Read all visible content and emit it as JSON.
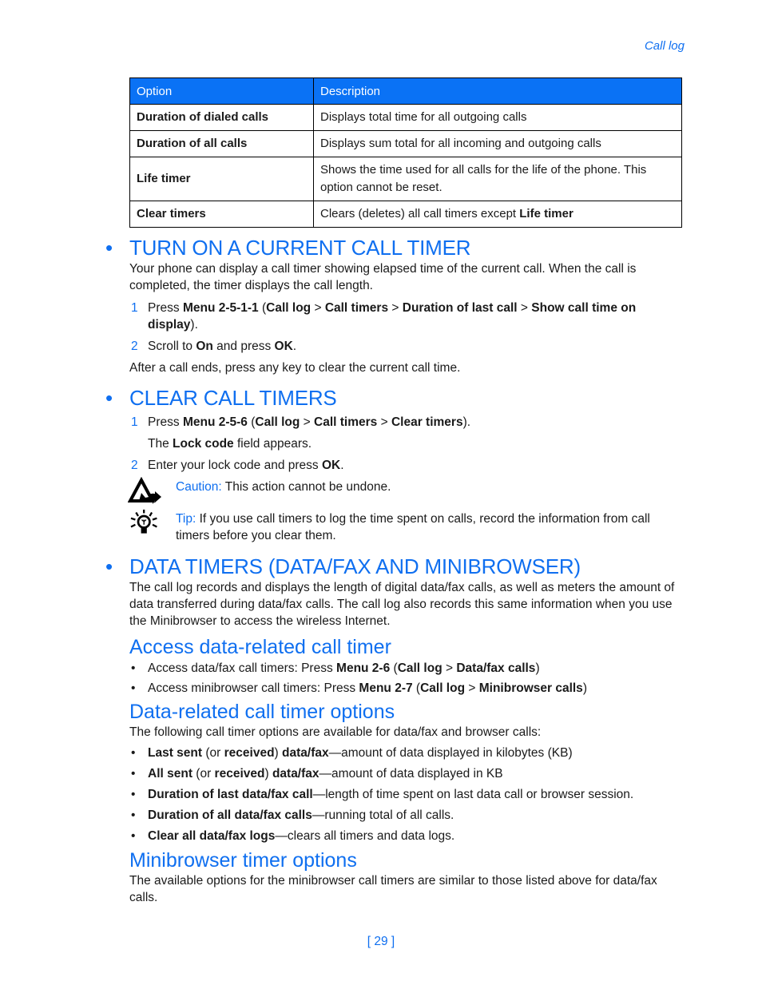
{
  "running_head": "Call log",
  "table": {
    "headers": [
      "Option",
      "Description"
    ],
    "rows": [
      {
        "option": "Duration of dialed calls",
        "description": "Displays total time for all outgoing calls"
      },
      {
        "option": "Duration of all calls",
        "description": "Displays sum total for all incoming and outgoing calls"
      },
      {
        "option": "Life timer",
        "description": "Shows the time used for all calls for the life of the phone. This option cannot be reset."
      },
      {
        "option": "Clear timers",
        "description_pre": "Clears (deletes) all call timers except ",
        "description_bold": "Life timer"
      }
    ]
  },
  "sections": {
    "current_timer": {
      "bullet": "•",
      "title": "TURN ON A CURRENT CALL TIMER",
      "intro": "Your phone can display a call timer showing elapsed time of the current call. When the call is completed, the timer displays the call length.",
      "step1": {
        "num": "1",
        "t1": "Press ",
        "b1": "Menu 2-5-1-1",
        "t2": " (",
        "b2": "Call log",
        "t3": " > ",
        "b3": "Call timers",
        "t4": " > ",
        "b4": "Duration of last call",
        "t5": " > ",
        "b5": "Show call time on display",
        "t6": ")."
      },
      "step2": {
        "num": "2",
        "t1": "Scroll to ",
        "b1": "On",
        "t2": " and press ",
        "b2": "OK",
        "t3": "."
      },
      "after": "After a call ends, press any key to clear the current call time."
    },
    "clear_timers": {
      "bullet": "•",
      "title": "CLEAR CALL TIMERS",
      "step1": {
        "num": "1",
        "t1": "Press ",
        "b1": "Menu 2-5-6",
        "t2": " (",
        "b2": "Call log",
        "t3": " > ",
        "b3": "Call timers",
        "t4": " > ",
        "b4": "Clear timers",
        "t5": ")."
      },
      "step1_note": {
        "t1": "The ",
        "b1": "Lock code",
        "t2": " field appears."
      },
      "step2": {
        "num": "2",
        "t1": "Enter your lock code and press ",
        "b1": "OK",
        "t2": "."
      },
      "caution": {
        "icon": "caution-icon",
        "label": "Caution:",
        "text": " This action cannot be undone."
      },
      "tip": {
        "icon": "lightbulb-icon",
        "label": "Tip:",
        "text": " If you use call timers to log the time spent on calls, record the information from call timers before you clear them."
      }
    },
    "data_timers": {
      "bullet": "•",
      "title": "DATA TIMERS (DATA/FAX AND MINIBROWSER)",
      "intro": "The call log records and displays the length of digital data/fax calls, as well as meters the amount of data transferred during data/fax calls. The call log also records this same information when you use the Minibrowser to access the wireless Internet.",
      "access": {
        "title": "Access data-related call timer",
        "items": [
          {
            "t1": "Access data/fax call timers: Press ",
            "b1": "Menu 2-6",
            "t2": " (",
            "b2": "Call log",
            "t3": " > ",
            "b3": "Data/fax calls",
            "t4": ")"
          },
          {
            "t1": "Access minibrowser call timers: Press ",
            "b1": "Menu 2-7",
            "t2": " (",
            "b2": "Call log",
            "t3": " > ",
            "b3": "Minibrowser calls",
            "t4": ")"
          }
        ]
      },
      "options": {
        "title": "Data-related call timer options",
        "intro": "The following call timer options are available for data/fax and browser calls:",
        "items": [
          {
            "b1": "Last sent",
            "t1": " (or ",
            "b2": "received",
            "t2": ") ",
            "b3": "data/fax",
            "t3": "—amount of data displayed in kilobytes (KB)"
          },
          {
            "b1": "All sent",
            "t1": " (or ",
            "b2": "received",
            "t2": ") ",
            "b3": "data/fax",
            "t3": "—amount of data displayed in KB"
          },
          {
            "b1": "Duration of last data/fax call",
            "t1": "—length of time spent on last data call or browser session."
          },
          {
            "b1": "Duration of all data/fax calls",
            "t1": "—running total of all calls."
          },
          {
            "b1": "Clear all data/fax logs",
            "t1": "—clears all timers and data logs."
          }
        ]
      },
      "minibrowser": {
        "title": "Minibrowser timer options",
        "text": "The available options for the minibrowser call timers are similar to those listed above for data/fax calls."
      }
    }
  },
  "page_number": "[ 29 ]"
}
